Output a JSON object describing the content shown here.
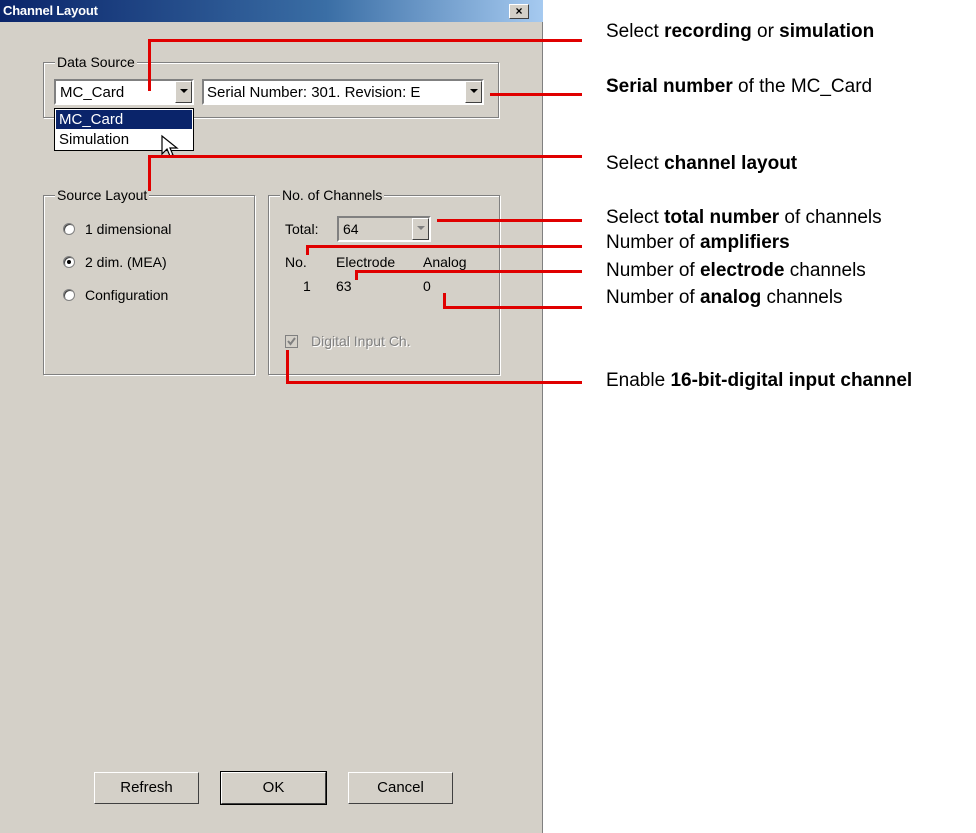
{
  "dialog": {
    "title": "Channel Layout",
    "close_glyph": "×",
    "data_source": {
      "legend": "Data Source",
      "selected": "MC_Card",
      "device_value": "Serial Number: 301. Revision: E",
      "dropdown_options": [
        "MC_Card",
        "Simulation"
      ]
    },
    "source_layout": {
      "legend": "Source Layout",
      "options": [
        "1 dimensional",
        "2 dim. (MEA)",
        "Configuration"
      ],
      "selected": "2 dim. (MEA)"
    },
    "channels": {
      "legend": "No. of Channels",
      "total_label": "Total:",
      "total_value": "64",
      "headers": [
        "No.",
        "Electrode",
        "Analog"
      ],
      "row": [
        "1",
        "63",
        "0"
      ],
      "digital_input_label": "Digital Input Ch.",
      "digital_input_checked": true
    },
    "buttons": {
      "refresh": "Refresh",
      "ok": "OK",
      "cancel": "Cancel"
    }
  },
  "annotations": [
    {
      "pre": "Select ",
      "b1": "recording",
      "mid": " or ",
      "b2": "simulation",
      "post": ""
    },
    {
      "pre": "",
      "b1": "Serial number",
      "mid": " of the MC_Card",
      "b2": "",
      "post": ""
    },
    {
      "pre": "Select ",
      "b1": "channel layout",
      "mid": "",
      "b2": "",
      "post": ""
    },
    {
      "pre": "Select ",
      "b1": "total number",
      "mid": " of channels",
      "b2": "",
      "post": ""
    },
    {
      "pre": "Number of ",
      "b1": "amplifiers",
      "mid": "",
      "b2": "",
      "post": ""
    },
    {
      "pre": "Number of ",
      "b1": "electrode",
      "mid": " channels",
      "b2": "",
      "post": ""
    },
    {
      "pre": "Number of ",
      "b1": "analog",
      "mid": " channels",
      "b2": "",
      "post": ""
    },
    {
      "pre": "Enable ",
      "b1": "16-bit-digital input channel",
      "mid": "",
      "b2": "",
      "post": ""
    }
  ],
  "colors": {
    "annotation_line": "#e00000",
    "title_bar": "#0a246a",
    "dialog_face": "#d4d0c8",
    "selection": "#0a246a"
  }
}
